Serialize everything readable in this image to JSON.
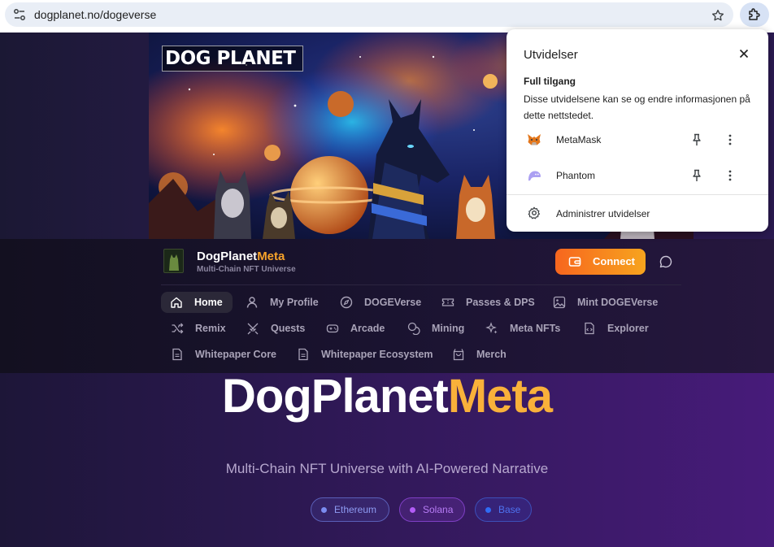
{
  "browser": {
    "url": "dogplanet.no/dogeverse"
  },
  "banner": {
    "logo_text": "DOG PLANET"
  },
  "header": {
    "brand_name": "DogPlanet",
    "brand_accent": "Meta",
    "brand_sub": "Multi-Chain NFT Universe",
    "connect_label": "Connect"
  },
  "nav": {
    "items": [
      {
        "label": "Home",
        "icon": "home-icon",
        "active": true
      },
      {
        "label": "My Profile",
        "icon": "user-icon"
      },
      {
        "label": "DOGEVerse",
        "icon": "compass-icon"
      },
      {
        "label": "Passes & DPS",
        "icon": "ticket-icon"
      },
      {
        "label": "Mint DOGEVerse",
        "icon": "image-icon"
      },
      {
        "label": "Remix",
        "icon": "shuffle-icon"
      },
      {
        "label": "Quests",
        "icon": "swords-icon"
      },
      {
        "label": "Arcade",
        "icon": "gamepad-icon"
      },
      {
        "label": "Mining",
        "icon": "coins-icon"
      },
      {
        "label": "Meta NFTs",
        "icon": "sparkles-icon"
      },
      {
        "label": "Explorer",
        "icon": "code-file-icon"
      },
      {
        "label": "Whitepaper Core",
        "icon": "document-icon"
      },
      {
        "label": "Whitepaper Ecosystem",
        "icon": "document-icon"
      },
      {
        "label": "Merch",
        "icon": "shopping-bag-icon"
      }
    ]
  },
  "hero": {
    "title": "DogPlanet",
    "title_accent": "Meta",
    "subtitle": "Multi-Chain NFT Universe with AI-Powered Narrative",
    "chains": [
      {
        "label": "Ethereum",
        "color": "#7b8cf0"
      },
      {
        "label": "Solana",
        "color": "#b25cf6"
      },
      {
        "label": "Base",
        "color": "#2f6cf5"
      }
    ]
  },
  "extensions_popup": {
    "title": "Utvidelser",
    "section_title": "Full tilgang",
    "section_desc": "Disse utvidelsene kan se og endre informasjonen på dette nettstedet.",
    "extensions": [
      {
        "name": "MetaMask",
        "icon": "metamask-icon"
      },
      {
        "name": "Phantom",
        "icon": "phantom-icon"
      }
    ],
    "manage_label": "Administrer utvidelser"
  },
  "colors": {
    "accent_orange": "#f7a32a",
    "connect_gradient_start": "#f7661e",
    "connect_gradient_end": "#f7a41e"
  }
}
